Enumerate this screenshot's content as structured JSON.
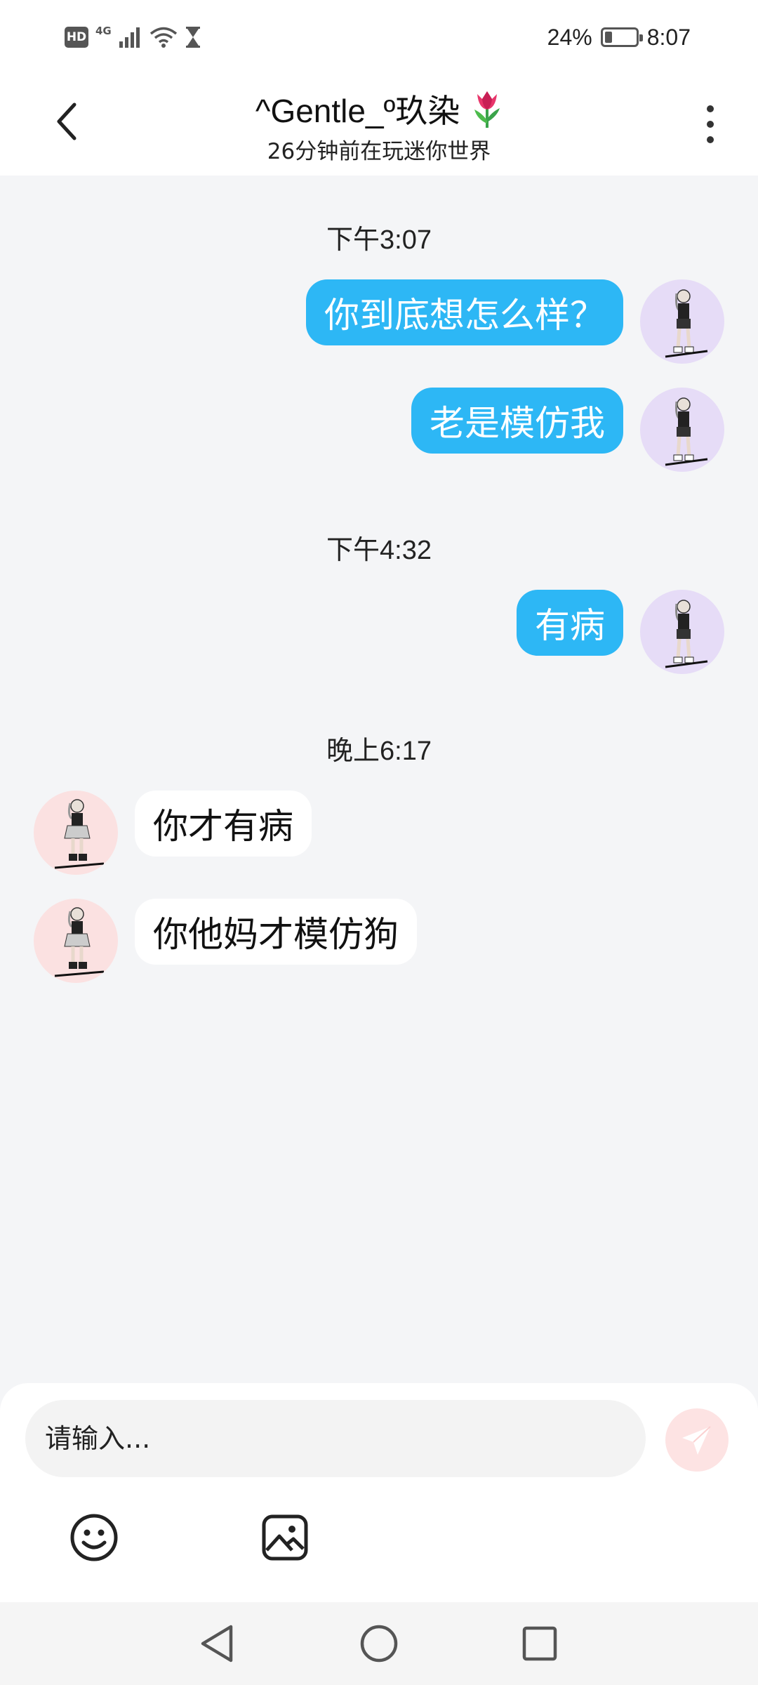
{
  "status_bar": {
    "hd": "HD",
    "network": "4G",
    "battery": "24%",
    "battery_level": 0.24,
    "time": "8:07"
  },
  "header": {
    "title": "^Gentle_º玖染",
    "subtitle": "26分钟前在玩迷你世界"
  },
  "colors": {
    "self_bubble": "#2db7f5",
    "other_bubble": "#ffffff",
    "background": "#f4f5f7",
    "self_avatar_bg": "#e6dcf7",
    "other_avatar_bg": "#fbe1e1"
  },
  "timestamps": [
    "下午3:07",
    "下午4:32",
    "晚上6:17"
  ],
  "messages": [
    {
      "from": "self",
      "text": "你到底想怎么样？"
    },
    {
      "from": "self",
      "text": "老是模仿我"
    },
    {
      "from": "self",
      "text": "有病"
    },
    {
      "from": "other",
      "text": "你才有病"
    },
    {
      "from": "other",
      "text": "你他妈才模仿狗"
    }
  ],
  "input": {
    "placeholder": "请输入..."
  },
  "icons": {
    "back": "chevron-left-icon",
    "more": "more-vertical-icon",
    "send": "paper-plane-icon",
    "emoji": "smiley-icon",
    "image": "image-icon"
  }
}
